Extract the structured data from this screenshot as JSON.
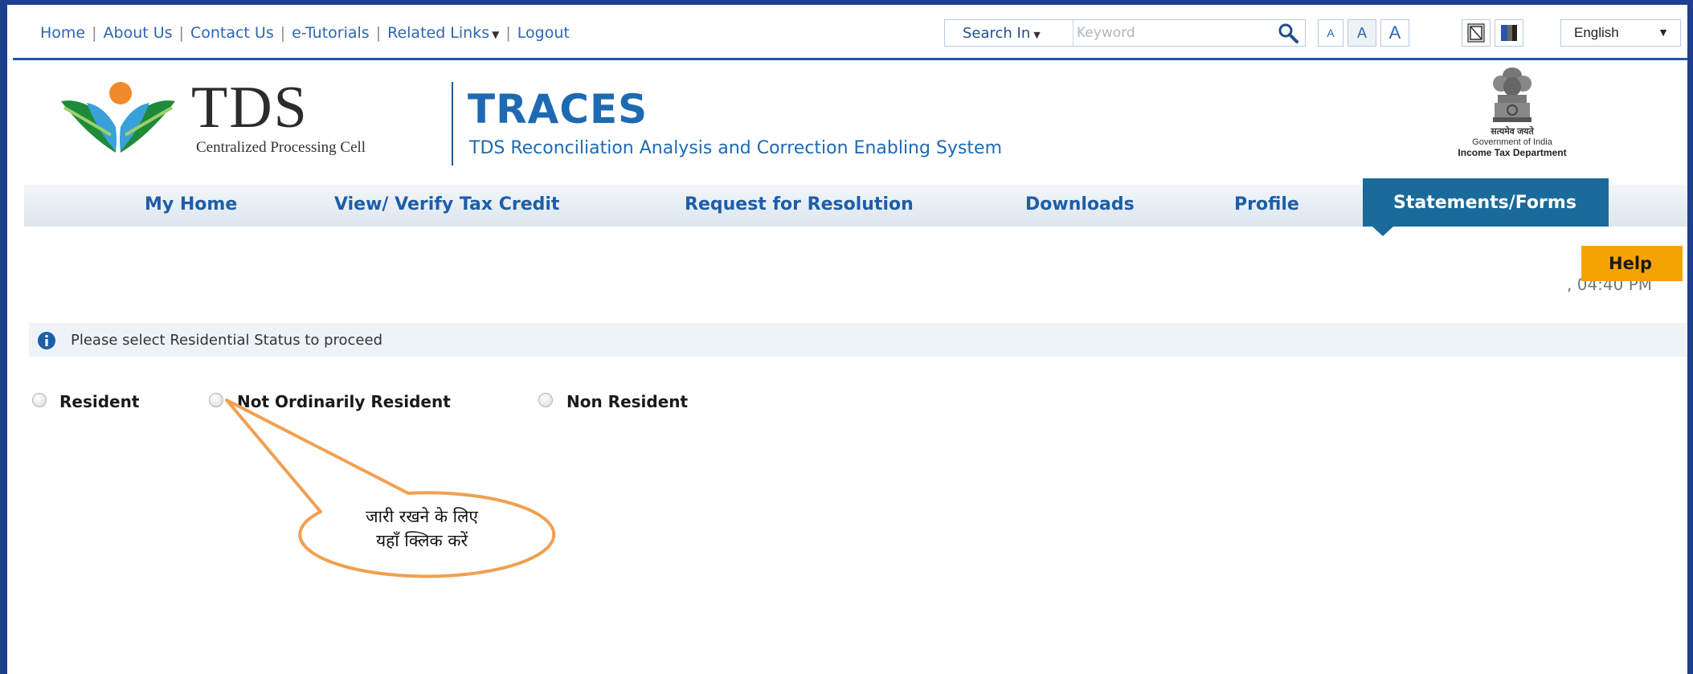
{
  "top_nav": {
    "links": [
      "Home",
      "About Us",
      "Contact Us",
      "e-Tutorials",
      "Related Links",
      "Logout"
    ],
    "search_in_label": "Search In",
    "search_placeholder": "Keyword",
    "font_buttons": [
      "A",
      "A",
      "A"
    ],
    "language": "English"
  },
  "header": {
    "tds_title": "TDS",
    "tds_subtitle": "Centralized Processing Cell",
    "traces_title": "TRACES",
    "traces_subtitle": "TDS Reconciliation Analysis and Correction Enabling System",
    "emblem_motto": "सत्यमेव जयते",
    "gov_line1": "Government of India",
    "gov_line2": "Income Tax Department"
  },
  "main_nav": {
    "items": [
      "My Home",
      "View/ Verify Tax Credit",
      "Request for Resolution",
      "Downloads",
      "Profile",
      "Statements/Forms"
    ],
    "active": "Statements/Forms"
  },
  "help_label": "Help",
  "time_partial": ", 04:40 PM",
  "info_message": "Please select Residential Status to proceed",
  "residential_options": [
    "Resident",
    "Not Ordinarily Resident",
    "Non Resident"
  ],
  "callout": {
    "line1": "जारी रखने के लिए",
    "line2": "यहाँ क्लिक करें"
  },
  "colors": {
    "frame": "#1e3f8e",
    "link_blue": "#2b66b4",
    "nav_active_bg": "#1a6a9a",
    "help_bg": "#f5a300",
    "callout_orange": "#f0a050"
  }
}
